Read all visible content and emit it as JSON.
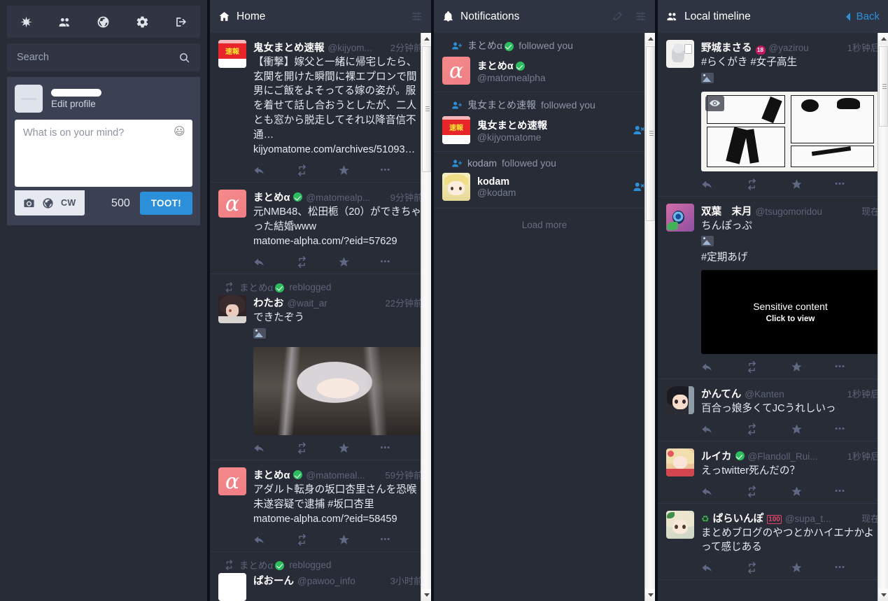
{
  "sidebar": {
    "nav": [
      {
        "name": "asterisk-icon",
        "label": "Home"
      },
      {
        "name": "users-icon",
        "label": "Local timeline"
      },
      {
        "name": "globe-icon",
        "label": "Federated timeline"
      },
      {
        "name": "gear-icon",
        "label": "Preferences"
      },
      {
        "name": "logout-icon",
        "label": "Logout"
      }
    ],
    "search": {
      "placeholder": "Search",
      "value": ""
    },
    "profile": {
      "edit_label": "Edit profile",
      "display_name_redacted": true
    },
    "compose": {
      "placeholder": "What is on your mind?",
      "value": "",
      "emoji": "😃",
      "tools": [
        {
          "name": "camera-icon",
          "label": "Add media"
        },
        {
          "name": "globe-icon",
          "label": "Adjust status visibility"
        },
        {
          "name": "cw-button",
          "label": "CW"
        }
      ],
      "char_count": "500",
      "toot_label": "TOOT!"
    }
  },
  "columns": {
    "home": {
      "title": "Home",
      "icon": "home-icon",
      "settings_icon": "sliders-icon",
      "statuses": [
        {
          "avatar": "av-kijyo",
          "display_name": "鬼女まとめ速報",
          "verified": false,
          "acct": "@kijyom...",
          "timestamp": "2分钟前",
          "content": "【衝撃】嫁父と一緒に帰宅したら、玄関を開けた瞬間に裸エプロンで間男にご飯をよそってる嫁の姿が。服を着せて話し合おうとしたが、二人とも窓から脱走してそれ以降音信不通…",
          "link": "kijyomatome.com/archives/51093…",
          "reblogged_by": null,
          "media": null
        },
        {
          "avatar": "av-alpha",
          "display_name": "まとめα",
          "verified": true,
          "acct": "@matomealp...",
          "timestamp": "9分钟前",
          "content": "元NMB48、松田栀（20）ができちゃった結婚www",
          "link": "matome-alpha.com/?eid=57629",
          "reblogged_by": null,
          "media": null
        },
        {
          "avatar": "av-watao",
          "display_name": "わたお",
          "verified": false,
          "acct": "@wait_ar",
          "timestamp": "22分钟前",
          "content": "できたぞう",
          "link": null,
          "reblogged_by": "まとめα",
          "reblogged_verified": true,
          "reblog_label": "reblogged",
          "media": "art-girl",
          "has_attachment_mini": true
        },
        {
          "avatar": "av-alpha",
          "display_name": "まとめα",
          "verified": true,
          "acct": "@matomeal...",
          "timestamp": "59分钟前",
          "content": "アダルト転身の坂口杏里さんを恐喉未遂容疑で逮捕 #坂口杏里",
          "link": "matome-alpha.com/?eid=58459",
          "reblogged_by": null,
          "media": null
        },
        {
          "avatar": "av-pawoo",
          "display_name": "ぱおーん",
          "verified": false,
          "acct": "@pawoo_info",
          "timestamp": "3小时前",
          "content": "",
          "link": null,
          "reblogged_by": "まとめα",
          "reblogged_verified": true,
          "reblog_label": "reblogged",
          "media": null
        }
      ]
    },
    "notifications": {
      "title": "Notifications",
      "icon": "bell-icon",
      "clear_icon": "eraser-icon",
      "settings_icon": "sliders-icon",
      "items": [
        {
          "avatar": "av-alpha",
          "head_name": "まとめα",
          "head_verified": true,
          "head_action": "followed you",
          "display_name": "まとめα",
          "verified": true,
          "acct": "@matomealpha",
          "show_unfollow": false
        },
        {
          "avatar": "av-kijyo",
          "head_name": "鬼女まとめ速報",
          "head_verified": false,
          "head_action": "followed you",
          "display_name": "鬼女まとめ速報",
          "verified": false,
          "acct": "@kijyomatome",
          "show_unfollow": true
        },
        {
          "avatar": "av-kodam",
          "head_name": "kodam",
          "head_verified": false,
          "head_action": "followed you",
          "display_name": "kodam",
          "verified": false,
          "acct": "@kodam",
          "show_unfollow": true
        }
      ],
      "load_more": "Load more"
    },
    "local": {
      "title": "Local timeline",
      "icon": "users-icon",
      "back_label": "Back",
      "statuses": [
        {
          "avatar": "av-yazirou",
          "display_name": "野城まさる",
          "badge": "18",
          "verified": false,
          "acct": "@yazirou",
          "timestamp": "1秒钟后",
          "content": "#らくがき #女子高生",
          "has_attachment_mini": true,
          "media": "art-manga",
          "eye_toggle": true
        },
        {
          "avatar": "av-futaba",
          "display_name": "双葉　末月",
          "verified": false,
          "acct": "@tsugomoridou",
          "timestamp": "现在",
          "content": "ちんぽっぷ",
          "content2": "#定期あげ",
          "has_attachment_mini": true,
          "sensitive": {
            "title": "Sensitive content",
            "subtitle": "Click to view"
          }
        },
        {
          "avatar": "av-kanten",
          "display_name": "かんてん",
          "verified": false,
          "acct": "@Kanten",
          "timestamp": "1秒钟后",
          "content": "百合っ娘多くてJCうれしいっ"
        },
        {
          "avatar": "av-ruika",
          "display_name": "ルイカ",
          "verified": true,
          "acct": "@Flandoll_Rui...",
          "timestamp": "1秒钟后",
          "content": "えっtwitter死んだの？"
        },
        {
          "avatar": "av-supa",
          "display_name": "ぱらいんぽ",
          "prefix_emoji": "♻",
          "badge100": "100",
          "verified": false,
          "acct": "@supa_t...",
          "timestamp": "现在",
          "content": "まとめブログのやつとかハイエナかよって感じある"
        }
      ]
    }
  },
  "action_bar": {
    "reply": "reply-icon",
    "boost": "boost-icon",
    "favourite": "star-icon",
    "more": "•••"
  },
  "colors": {
    "accent": "#2b90d9",
    "panel": "#282c37",
    "panel_light": "#3b4152",
    "header": "#2f3443",
    "verified_green": "#2dbd60",
    "muted_text": "#5e6478"
  }
}
